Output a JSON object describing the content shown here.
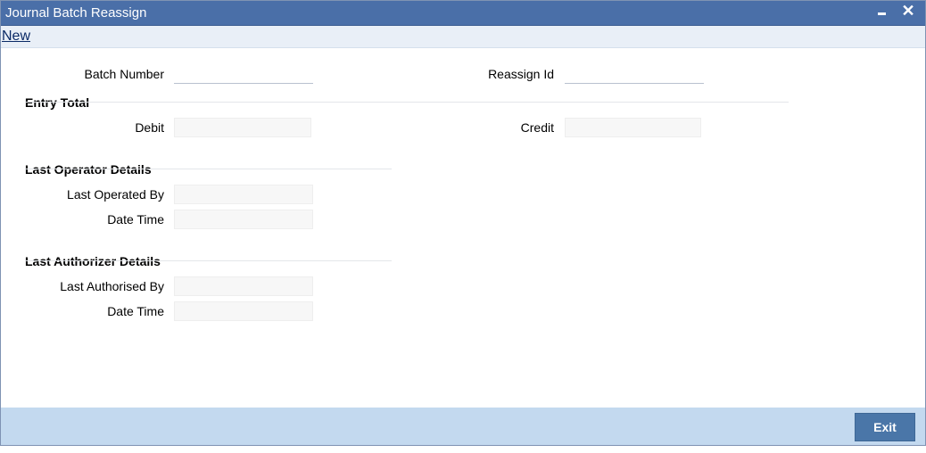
{
  "window": {
    "title": "Journal Batch Reassign",
    "minimize_icon": "minimize-icon",
    "close_icon": "close-icon",
    "close_glyph": "✕"
  },
  "toolbar": {
    "new_label": "New"
  },
  "form": {
    "batch_number": {
      "label": "Batch Number",
      "value": ""
    },
    "reassign_id": {
      "label": "Reassign Id",
      "value": ""
    }
  },
  "entry_total": {
    "heading": "Entry Total",
    "debit": {
      "label": "Debit",
      "value": ""
    },
    "credit": {
      "label": "Credit",
      "value": ""
    }
  },
  "last_operator": {
    "heading": "Last Operator Details",
    "operated_by": {
      "label": "Last Operated By",
      "value": ""
    },
    "date_time": {
      "label": "Date Time",
      "value": ""
    }
  },
  "last_authorizer": {
    "heading": "Last Authorizer Details",
    "authorised_by": {
      "label": "Last Authorised By",
      "value": ""
    },
    "date_time": {
      "label": "Date Time",
      "value": ""
    }
  },
  "footer": {
    "exit_label": "Exit"
  },
  "colors": {
    "titlebar": "#4a6fa8",
    "footer": "#c3d9ef",
    "exit_button": "#4a76a8"
  }
}
